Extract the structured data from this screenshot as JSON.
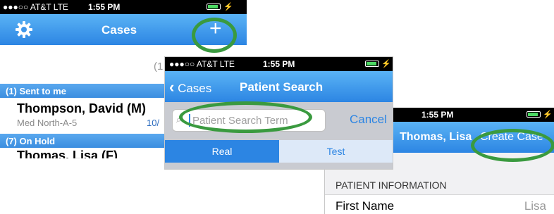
{
  "left": {
    "status": {
      "carrier": "●●●○○ AT&T  LTE",
      "time": "1:55 PM"
    },
    "nav": {
      "title": "Cases",
      "add": "+"
    },
    "count": "(1",
    "sections": [
      {
        "header": "(1) Sent to me",
        "name": "Thompson, David (M)",
        "location": "Med North-A-5",
        "date": "10/"
      },
      {
        "header": "(7) On Hold",
        "name": "Thomas, Lisa (F)"
      }
    ]
  },
  "middle": {
    "status": {
      "carrier": "●●●○○ AT&T  LTE",
      "time": "1:55 PM"
    },
    "nav": {
      "back": "Cases",
      "title": "Patient Search"
    },
    "search": {
      "placeholder": "Patient Search Term",
      "cancel": "Cancel"
    },
    "segments": [
      "Real",
      "Test"
    ]
  },
  "right": {
    "status": {
      "time": "1:55 PM"
    },
    "nav": {
      "title": "Thomas, Lisa",
      "action": "Create Case"
    },
    "section": "PATIENT INFORMATION",
    "field": {
      "label": "First Name",
      "value": "Lisa"
    }
  },
  "colors": {
    "accent": "#2c85e3",
    "highlight": "#3a9a3f"
  }
}
